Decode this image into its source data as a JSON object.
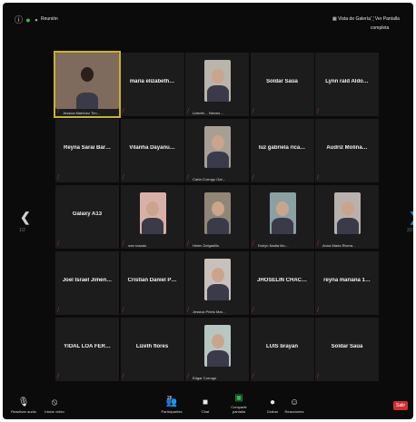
{
  "topbar": {
    "meeting_label": "Reunión",
    "view_gallery": "Vista de Galería",
    "fullscreen": "Ver Pantalla completa"
  },
  "colors": {
    "background": "#0b0b0b",
    "tile": "#1c1c1c",
    "active_border": "#c9b22a",
    "muted": "#e04545",
    "nav_left": "#cfcfcf",
    "nav_right": "#2a8ad6",
    "leave": "#d12f2f",
    "share": "#2db84a"
  },
  "nav": {
    "left_page": "1/2",
    "right_page": "2/2"
  },
  "participants": [
    {
      "name": "",
      "label": "Jessica Martínez Tim…",
      "photo": "#7f6b5b"
    },
    {
      "name": "maria elizabeth…",
      "label": "",
      "photo": null
    },
    {
      "name": "",
      "label": "Lizbeth… Nieves…",
      "photo": "#b9b4ac"
    },
    {
      "name": "Soldar Saúa",
      "label": "",
      "photo": null
    },
    {
      "name": "Lynn rald Aldo…",
      "label": "",
      "photo": null
    },
    {
      "name": "Reyna Sarai Bar…",
      "label": "",
      "photo": null
    },
    {
      "name": "Vilanha Dayanu…",
      "label": "",
      "photo": null
    },
    {
      "name": "",
      "label": "Carla Corrugo Gal…",
      "photo": "#a89f94"
    },
    {
      "name": "luz gabriela rica…",
      "label": "",
      "photo": null
    },
    {
      "name": "Audriz Molina…",
      "label": "",
      "photo": null
    },
    {
      "name": "Galaxy A13",
      "label": "",
      "photo": null
    },
    {
      "name": "",
      "label": "ivan rosado",
      "photo": "#d9b0a5"
    },
    {
      "name": "",
      "label": "Helen Delgadillo",
      "photo": "#8f8676"
    },
    {
      "name": "",
      "label": "Evelyn Nadia Mo…",
      "photo": "#8aa0a2"
    },
    {
      "name": "",
      "label": "Anna Maria Rivera…",
      "photo": "#b8b1ad"
    },
    {
      "name": "Joel Israel Jimen…",
      "label": "",
      "photo": null
    },
    {
      "name": "Cristian Daniel P…",
      "label": "",
      "photo": null
    },
    {
      "name": "",
      "label": "Jessica Prieto Mar…",
      "photo": "#c8c0bb"
    },
    {
      "name": "JHOSELIN CHAC…",
      "label": "",
      "photo": null
    },
    {
      "name": "reyna mariana 1…",
      "label": "",
      "photo": null
    },
    {
      "name": "YIDAL LOA FER…",
      "label": "",
      "photo": null
    },
    {
      "name": "Lizeth flores",
      "label": "",
      "photo": null
    },
    {
      "name": "",
      "label": "Edgar Corrugo",
      "photo": "#b6c7c2"
    },
    {
      "name": "LUIS brayan",
      "label": "",
      "photo": null
    },
    {
      "name": "Soldar Saúa",
      "label": "",
      "photo": null
    }
  ],
  "bottombar": {
    "mute": "Reactivar audio",
    "video": "Iniciar vídeo",
    "participants": "Participantes",
    "participants_count": "26",
    "chat": "Chat",
    "share": "Compartir pantalla",
    "record": "Grabar",
    "reactions": "Reacciones",
    "leave": "Salir"
  }
}
